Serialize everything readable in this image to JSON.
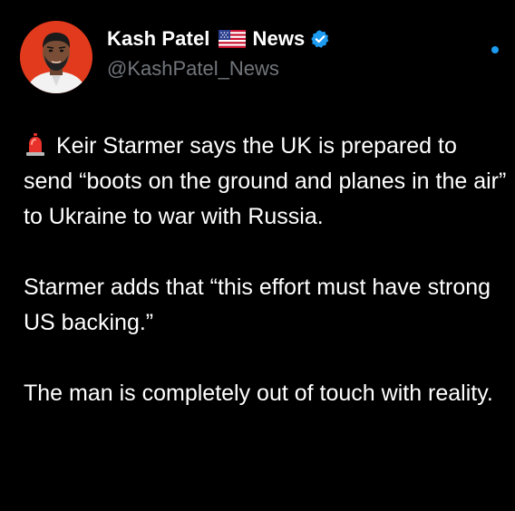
{
  "tweet": {
    "author": {
      "name": "Kash Patel",
      "name_suffix": "News",
      "handle": "@KashPatel_News",
      "flag_icon": "us-flag-icon",
      "verified_icon": "verified-badge-icon"
    },
    "paragraphs": [
      "Keir Starmer says the UK is prepared to send “boots on the ground and planes in the air” to Ukraine to war with Russia.",
      "Starmer adds that “this effort must have strong US backing.”",
      "The man is completely out of touch with reality."
    ],
    "leading_icon": "siren-icon"
  },
  "colors": {
    "background": "#000000",
    "text": "#ffffff",
    "secondary_text": "#71767b",
    "accent": "#1d9bf0",
    "avatar_bg": "#e23a1c"
  }
}
